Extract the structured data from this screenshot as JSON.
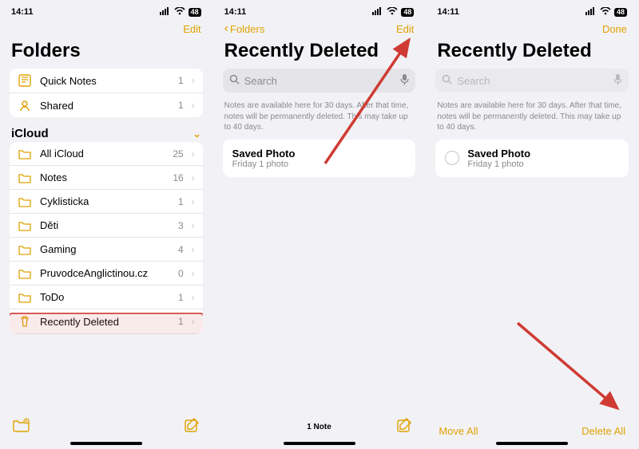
{
  "c": {
    "accent": "#e0a100",
    "muted": "#8a8a8e",
    "divider": "#e5e5ea",
    "highlight": "#d85b57",
    "arrow": "#cf3b33"
  },
  "status": {
    "time": "14:11",
    "battery": "48"
  },
  "s1": {
    "nav_right": "Edit",
    "title": "Folders",
    "quick": [
      {
        "label": "Quick Notes",
        "count": "1",
        "icon": "quick"
      },
      {
        "label": "Shared",
        "count": "1",
        "icon": "shared"
      }
    ],
    "section": "iCloud",
    "folders": [
      {
        "label": "All iCloud",
        "count": "25"
      },
      {
        "label": "Notes",
        "count": "16"
      },
      {
        "label": "Cyklisticka",
        "count": "1"
      },
      {
        "label": "Děti",
        "count": "3"
      },
      {
        "label": "Gaming",
        "count": "4"
      },
      {
        "label": "PruvodceAnglictinou.cz",
        "count": "0"
      },
      {
        "label": "ToDo",
        "count": "1"
      },
      {
        "label": "Recently Deleted",
        "count": "1",
        "icon": "trash"
      }
    ]
  },
  "s2": {
    "nav_left": "Folders",
    "nav_right": "Edit",
    "title": "Recently Deleted",
    "search_placeholder": "Search",
    "info": "Notes are available here for 30 days. After that time, notes will be permanently deleted. This may take up to 40 days.",
    "note_title": "Saved Photo",
    "note_sub": "Friday  1 photo",
    "footer_center": "1 Note"
  },
  "s3": {
    "nav_right": "Done",
    "title": "Recently Deleted",
    "search_placeholder": "Search",
    "info": "Notes are available here for 30 days. After that time, notes will be permanently deleted. This may take up to 40 days.",
    "note_title": "Saved Photo",
    "note_sub": "Friday  1 photo",
    "footer_left": "Move All",
    "footer_right": "Delete All"
  }
}
